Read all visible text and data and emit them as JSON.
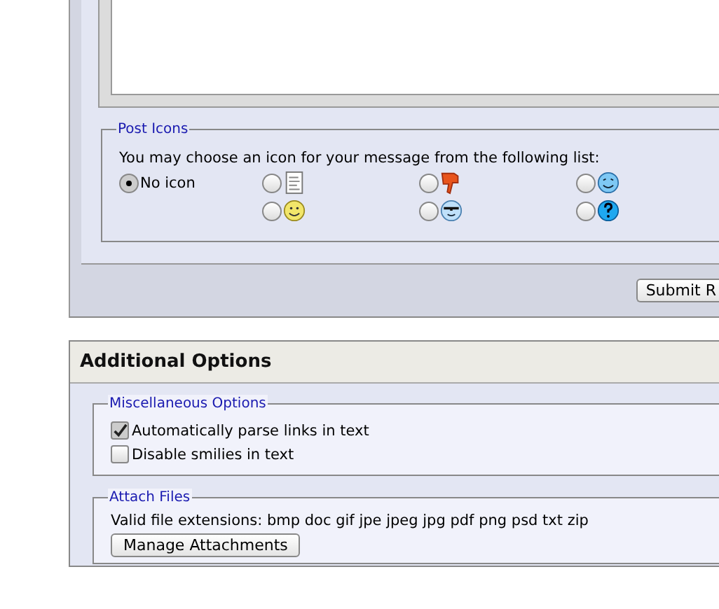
{
  "post_icons": {
    "legend": "Post Icons",
    "prompt": "You may choose an icon for your message from the following list:",
    "options": [
      {
        "kind": "none",
        "label": "No icon",
        "selected": true
      },
      {
        "kind": "document",
        "selected": false
      },
      {
        "kind": "thumbs-down",
        "selected": false
      },
      {
        "kind": "wink",
        "selected": false
      },
      {
        "kind": "smile",
        "selected": false
      },
      {
        "kind": "cool",
        "selected": false
      },
      {
        "kind": "question",
        "selected": false
      }
    ]
  },
  "submit_button": "Submit R",
  "additional_options": {
    "title": "Additional Options",
    "misc": {
      "legend": "Miscellaneous Options",
      "checkboxes": [
        {
          "label": "Automatically parse links in text",
          "checked": true
        },
        {
          "label": "Disable smilies in text",
          "checked": false
        }
      ]
    },
    "attach": {
      "legend": "Attach Files",
      "extensions": "Valid file extensions: bmp doc gif jpe jpeg jpg pdf png psd txt zip",
      "button": "Manage Attachments"
    }
  }
}
